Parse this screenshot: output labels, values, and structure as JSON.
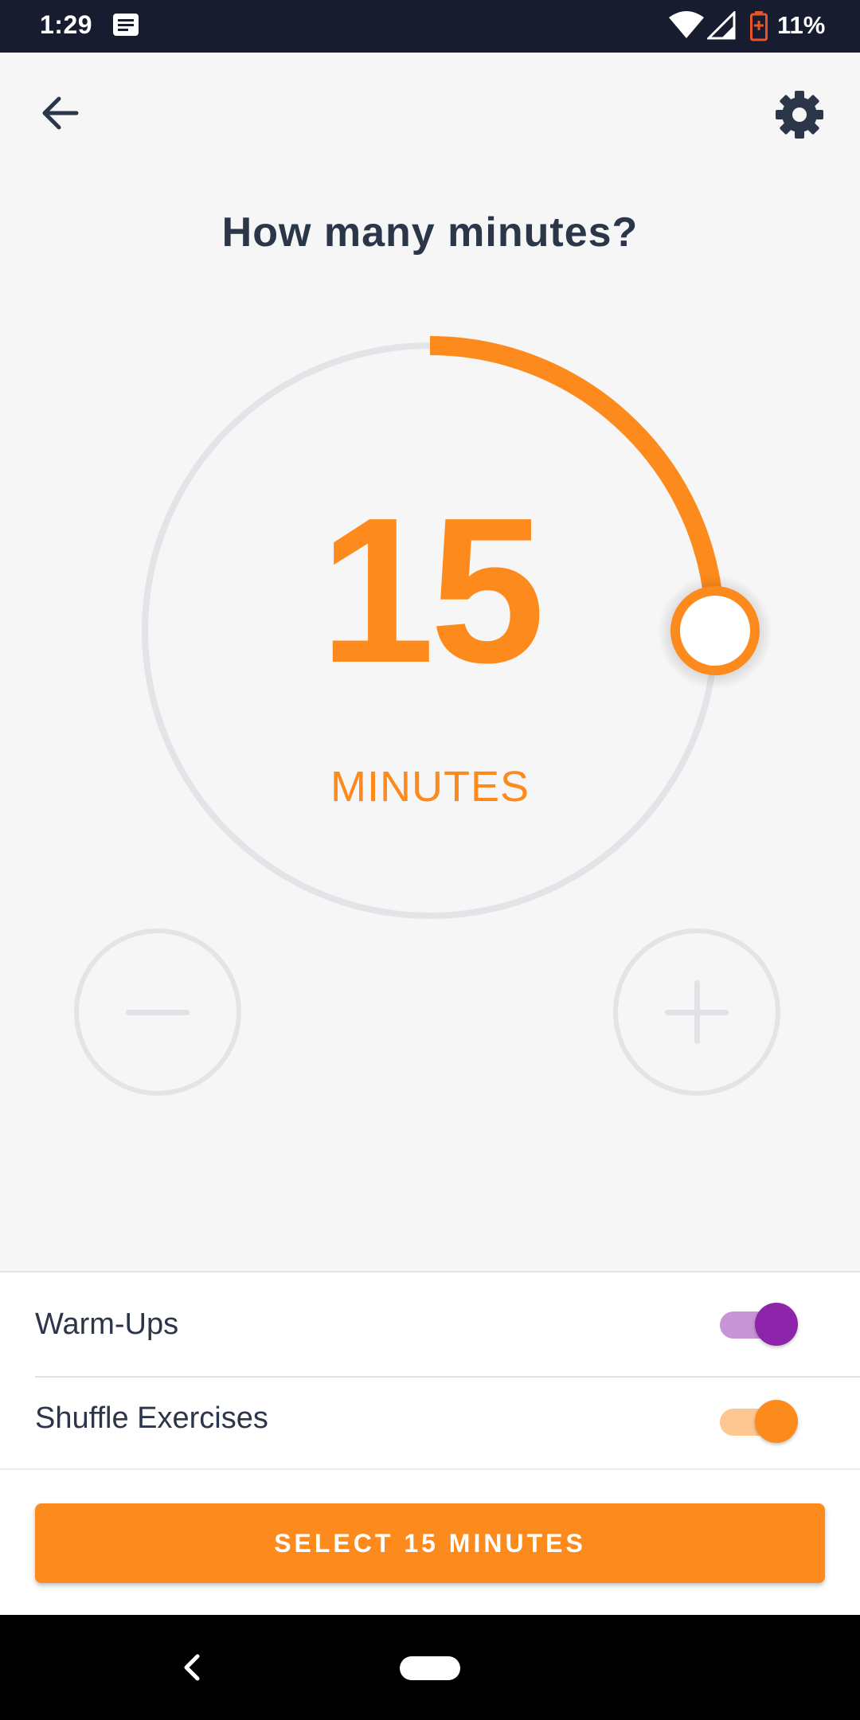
{
  "status_bar": {
    "time": "1:29",
    "battery_percent": "11%",
    "icons": [
      "message-icon",
      "wifi-icon",
      "signal-icon",
      "battery-low-icon"
    ]
  },
  "app_bar": {
    "back_icon": "arrow-left-icon",
    "settings_icon": "gear-icon"
  },
  "title": "How many minutes?",
  "dial": {
    "value": "15",
    "unit": "MINUTES",
    "fraction": 0.25,
    "accent_color": "#fd8a1c",
    "track_color": "#e3e4e8"
  },
  "steppers": {
    "minus_icon": "minus-icon",
    "plus_icon": "plus-icon"
  },
  "options": [
    {
      "label": "Warm-Ups",
      "enabled": true,
      "color": "#8e24aa",
      "track_color": "#c795d6"
    },
    {
      "label": "Shuffle Exercises",
      "enabled": true,
      "color": "#fd8a1c",
      "track_color": "#fec691"
    }
  ],
  "cta": {
    "label": "SELECT 15 MINUTES"
  },
  "nav_bar": {
    "back_icon": "nav-back-icon",
    "home_icon": "nav-home-pill"
  }
}
